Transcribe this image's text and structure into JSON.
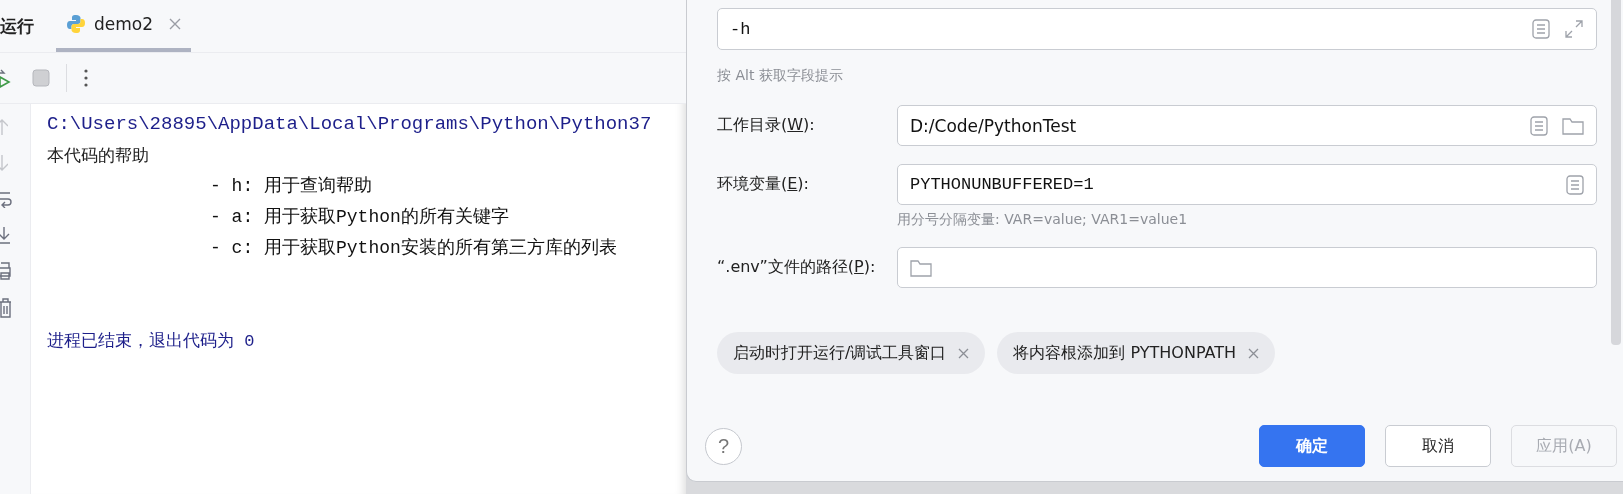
{
  "run_panel": {
    "title": "运行",
    "tabs": [
      {
        "label": "demo2",
        "selected": true
      }
    ],
    "console_lines": [
      {
        "kind": "command",
        "text": "C:\\Users\\28895\\AppData\\Local\\Programs\\Python\\Python37"
      },
      {
        "kind": "output",
        "text": "本代码的帮助"
      },
      {
        "kind": "option",
        "text": "- h: 用于查询帮助"
      },
      {
        "kind": "option",
        "text": "- a: 用于获取Python的所有关键字"
      },
      {
        "kind": "option",
        "text": "- c: 用于获取Python安装的所有第三方库的列表"
      },
      {
        "kind": "exit",
        "text": "进程已结束，退出代码为 0"
      }
    ]
  },
  "dialog": {
    "help_button": "?",
    "parameters_field": {
      "value": "-h"
    },
    "hint": "按 Alt 获取字段提示",
    "fields": [
      {
        "kind": "directory",
        "label_before": "工作目录(",
        "mnemonic": "W",
        "label_after": "):",
        "value": "D:/Code/PythonTest"
      },
      {
        "kind": "env",
        "label_before": "环境变量(",
        "mnemonic": "E",
        "label_after": "):",
        "value": "PYTHONUNBUFFERED=1",
        "hint": "用分号分隔变量: VAR=value; VAR1=value1"
      },
      {
        "kind": "file",
        "label_before": "“.env”文件的路径(",
        "mnemonic": "P",
        "label_after": "):"
      }
    ],
    "chips": [
      "启动时打开运行/调试工具窗口",
      "将内容根添加到 PYTHONPATH"
    ],
    "buttons": [
      {
        "label": "确定",
        "kind": "primary",
        "disabled": false
      },
      {
        "label": "取消",
        "kind": "default",
        "disabled": false
      },
      {
        "label": "应用(A)",
        "kind": "default",
        "disabled": true
      }
    ]
  }
}
